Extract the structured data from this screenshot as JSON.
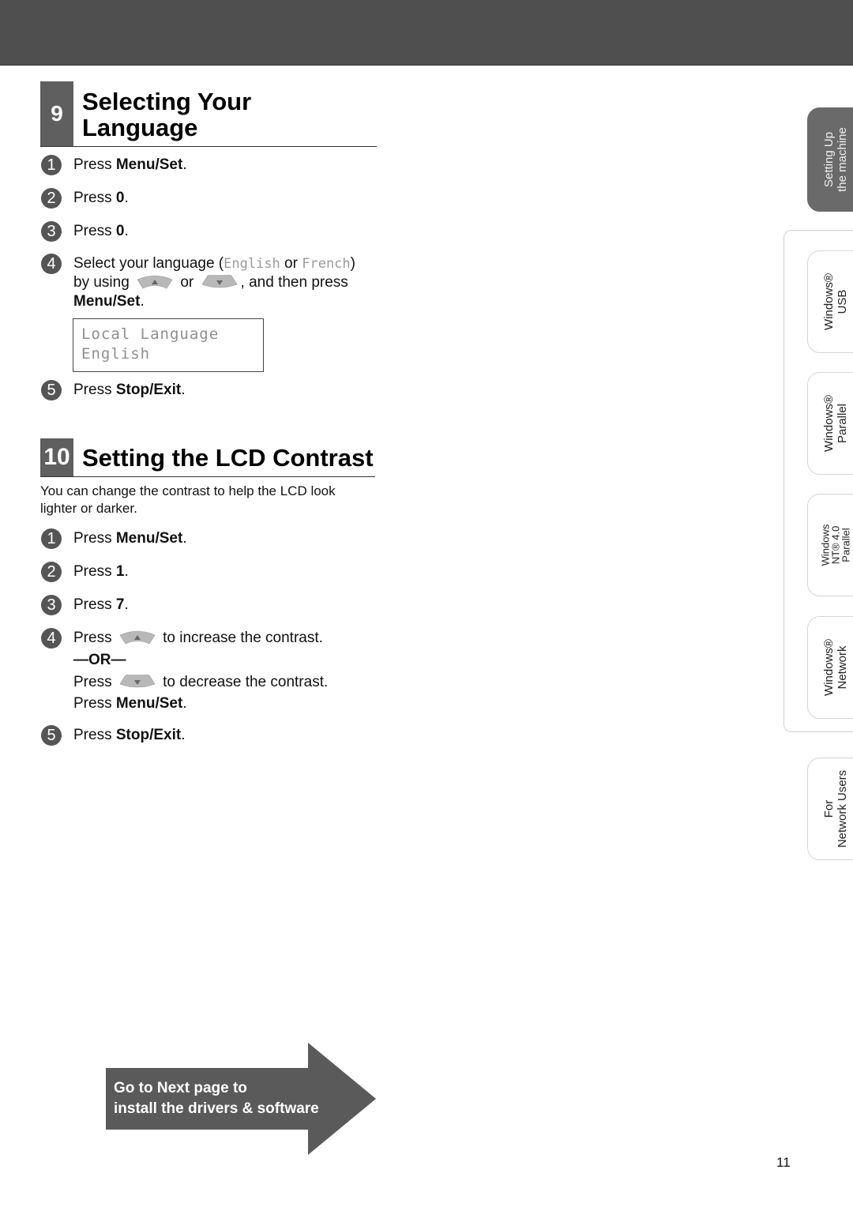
{
  "header": {
    "bar_color": "#4f4f4f"
  },
  "section9": {
    "number": "9",
    "title_line1": "Selecting Your",
    "title_line2": "Language",
    "steps": [
      {
        "num": "1",
        "pre": "Press ",
        "bold": "Menu/Set",
        "post": "."
      },
      {
        "num": "2",
        "pre": "Press ",
        "bold": "0",
        "post": "."
      },
      {
        "num": "3",
        "pre": "Press ",
        "bold": "0",
        "post": "."
      },
      {
        "num": "4",
        "line1_pre": "Select your language (",
        "opt1": "English",
        "line1_mid": " or ",
        "opt2": "French",
        "line1_post": ")",
        "line2_pre": "by using",
        "line2_mid": "or",
        "line2_post": ", and then press",
        "line3_bold": "Menu/Set",
        "line3_post": "."
      },
      {
        "num": "5",
        "pre": "Press ",
        "bold": "Stop/Exit",
        "post": "."
      }
    ],
    "lcd": {
      "line1": "Local Language",
      "line2": "English"
    }
  },
  "section10": {
    "number": "10",
    "title": "Setting the LCD Contrast",
    "intro": "You can change the contrast to help the LCD look lighter or darker.",
    "steps": [
      {
        "num": "1",
        "pre": "Press ",
        "bold": "Menu/Set",
        "post": "."
      },
      {
        "num": "2",
        "pre": "Press ",
        "bold": "1",
        "post": "."
      },
      {
        "num": "3",
        "pre": "Press ",
        "bold": "7",
        "post": "."
      },
      {
        "num": "4",
        "increase_pre": "Press",
        "increase_post": "to increase the contrast.",
        "or": "—OR—",
        "decrease_pre": "Press",
        "decrease_post": "to decrease the contrast.",
        "final_pre": "Press ",
        "final_bold": "Menu/Set",
        "final_post": "."
      },
      {
        "num": "5",
        "pre": "Press ",
        "bold": "Stop/Exit",
        "post": "."
      }
    ]
  },
  "side_tabs": [
    {
      "line1": "Setting Up",
      "line2": "the machine",
      "active": true
    },
    {
      "line1": "Windows®",
      "line2": "USB",
      "active": false
    },
    {
      "line1": "Windows®",
      "line2": "Parallel",
      "active": false
    },
    {
      "line1": "Windows",
      "line2": "NT® 4.0",
      "line3": "Parallel",
      "active": false
    },
    {
      "line1": "Windows®",
      "line2": "Network",
      "active": false
    },
    {
      "line1": "For",
      "line2": "Network Users",
      "active": false
    }
  ],
  "next_page": {
    "line1": "Go to Next page to",
    "line2": "install the drivers & software"
  },
  "page_number": "11",
  "icons": {
    "up_key": "up-arrow-key-icon",
    "down_key": "down-arrow-key-icon"
  }
}
